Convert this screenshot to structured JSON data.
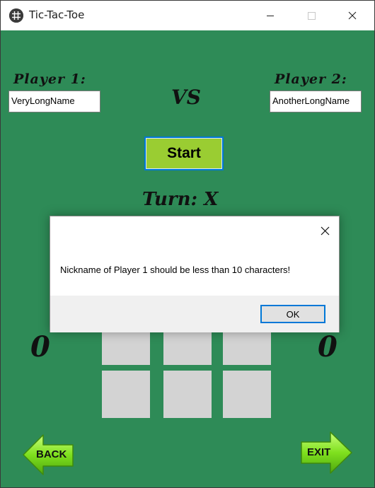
{
  "window": {
    "title": "Tic-Tac-Toe",
    "icon": "app-icon"
  },
  "game": {
    "player1_label": "Player 1:",
    "player2_label": "Player 2:",
    "player1_name": "VeryLongName",
    "player2_name": "AnotherLongName",
    "vs_label": "VS",
    "start_label": "Start",
    "turn_label": "Turn: X",
    "score_player1": "0",
    "score_player2": "0",
    "back_label": "BACK",
    "exit_label": "EXIT"
  },
  "dialog": {
    "message": "Nickname of Player 1 should be less than 10 characters!",
    "ok_label": "OK"
  },
  "colors": {
    "background": "#2e8b57",
    "start_button": "#9acd32",
    "cell": "#d3d3d3",
    "arrow": "#7fe01e",
    "focus_border": "#0078d7"
  }
}
